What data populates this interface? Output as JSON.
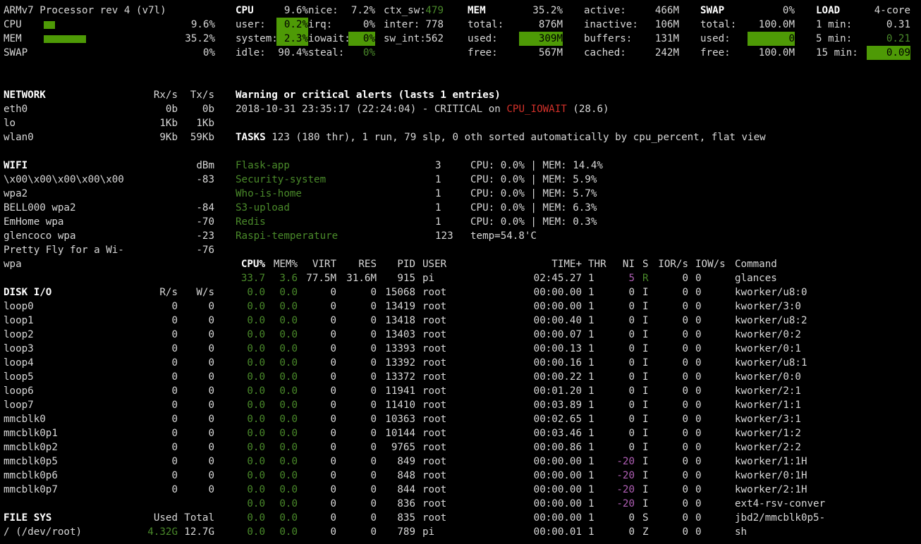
{
  "quicklook": {
    "processor": "ARMv7 Processor rev 4 (v7l)",
    "rows": [
      {
        "label": "CPU",
        "value": "9.6%",
        "fraction": 0.096
      },
      {
        "label": "MEM",
        "value": "35.2%",
        "fraction": 0.352
      },
      {
        "label": "SWAP",
        "value": "0%",
        "fraction": 0
      }
    ]
  },
  "cpu": {
    "title": "CPU",
    "total": "9.6%",
    "rows": [
      {
        "label": "user:",
        "value": "0.2%"
      },
      {
        "label": "system:",
        "value": "2.3%"
      },
      {
        "label": "idle:",
        "value": "90.4%"
      }
    ],
    "rows2": [
      {
        "label": "nice:",
        "value": "7.2%"
      },
      {
        "label": "irq:",
        "value": "0%"
      },
      {
        "label": "iowait:",
        "value": "0%"
      },
      {
        "label": "steal:",
        "value": "0%"
      }
    ],
    "rows3": [
      {
        "label": "ctx_sw:",
        "value": "479"
      },
      {
        "label": "inter:",
        "value": "778"
      },
      {
        "label": "sw_int:",
        "value": "562"
      }
    ]
  },
  "mem": {
    "title": "MEM",
    "percent": "35.2%",
    "rows": [
      {
        "label": "total:",
        "value": "876M"
      },
      {
        "label": "used:",
        "value": "309M"
      },
      {
        "label": "free:",
        "value": "567M"
      }
    ],
    "rows2": [
      {
        "label": "active:",
        "value": "466M"
      },
      {
        "label": "inactive:",
        "value": "106M"
      },
      {
        "label": "buffers:",
        "value": "131M"
      },
      {
        "label": "cached:",
        "value": "242M"
      }
    ]
  },
  "swap": {
    "title": "SWAP",
    "percent": "0%",
    "rows": [
      {
        "label": "total:",
        "value": "100.0M"
      },
      {
        "label": "used:",
        "value": "0"
      },
      {
        "label": "free:",
        "value": "100.0M"
      }
    ]
  },
  "load": {
    "title": "LOAD",
    "cores": "4-core",
    "rows": [
      {
        "label": "1 min:",
        "value": "0.31"
      },
      {
        "label": "5 min:",
        "value": "0.21"
      },
      {
        "label": "15 min:",
        "value": "0.09"
      }
    ]
  },
  "network": {
    "title": "NETWORK",
    "rx": "Rx/s",
    "tx": "Tx/s",
    "rows": [
      {
        "name": "eth0",
        "rx": "0b",
        "tx": "0b"
      },
      {
        "name": "lo",
        "rx": "1Kb",
        "tx": "1Kb"
      },
      {
        "name": "wlan0",
        "rx": "9Kb",
        "tx": "59Kb"
      }
    ]
  },
  "wifi": {
    "title": "WIFI",
    "unit": "dBm",
    "rows": [
      {
        "name": "\\x00\\x00\\x00\\x00\\x00",
        "value": "-83"
      },
      {
        "name": "wpa2",
        "value": ""
      },
      {
        "name": "BELL000 wpa2",
        "value": "-84"
      },
      {
        "name": "EmHome wpa",
        "value": "-70"
      },
      {
        "name": "glencoco wpa",
        "value": "-23"
      },
      {
        "name": "Pretty Fly for a Wi-",
        "value": "-76"
      },
      {
        "name": "wpa",
        "value": ""
      }
    ]
  },
  "disk": {
    "title": "DISK I/O",
    "r": "R/s",
    "w": "W/s",
    "rows": [
      {
        "name": "loop0",
        "r": "0",
        "w": "0"
      },
      {
        "name": "loop1",
        "r": "0",
        "w": "0"
      },
      {
        "name": "loop2",
        "r": "0",
        "w": "0"
      },
      {
        "name": "loop3",
        "r": "0",
        "w": "0"
      },
      {
        "name": "loop4",
        "r": "0",
        "w": "0"
      },
      {
        "name": "loop5",
        "r": "0",
        "w": "0"
      },
      {
        "name": "loop6",
        "r": "0",
        "w": "0"
      },
      {
        "name": "loop7",
        "r": "0",
        "w": "0"
      },
      {
        "name": "mmcblk0",
        "r": "0",
        "w": "0"
      },
      {
        "name": "mmcblk0p1",
        "r": "0",
        "w": "0"
      },
      {
        "name": "mmcblk0p2",
        "r": "0",
        "w": "0"
      },
      {
        "name": "mmcblk0p5",
        "r": "0",
        "w": "0"
      },
      {
        "name": "mmcblk0p6",
        "r": "0",
        "w": "0"
      },
      {
        "name": "mmcblk0p7",
        "r": "0",
        "w": "0"
      }
    ]
  },
  "fs": {
    "title": "FILE SYS",
    "used": "Used",
    "total": "Total",
    "rows": [
      {
        "name": "/ (/dev/root)",
        "used": "4.32G",
        "total": "12.7G"
      }
    ]
  },
  "alerts": {
    "title": "Warning or critical alerts (lasts 1 entries)",
    "entry_prefix": "2018-10-31 23:35:17 (22:24:04) - CRITICAL on ",
    "entry_key": "CPU_IOWAIT",
    "entry_suffix": " (28.6)"
  },
  "tasks": {
    "label": "TASKS",
    "summary": " 123 (180 thr), 1 run, 79 slp, 0 oth sorted automatically by cpu_percent, flat view"
  },
  "amps": [
    {
      "name": "Flask-app",
      "count": "3",
      "info": "CPU: 0.0% | MEM: 14.4%"
    },
    {
      "name": "Security-system",
      "count": "1",
      "info": "CPU: 0.0% | MEM: 5.9%"
    },
    {
      "name": "Who-is-home",
      "count": "1",
      "info": "CPU: 0.0% | MEM: 5.7%"
    },
    {
      "name": "S3-upload",
      "count": "1",
      "info": "CPU: 0.0% | MEM: 6.3%"
    },
    {
      "name": "Redis",
      "count": "1",
      "info": "CPU: 0.0% | MEM: 0.3%"
    },
    {
      "name": "Raspi-temperature",
      "count": "123",
      "info": "temp=54.8'C"
    }
  ],
  "proc_headers": {
    "cpu": "CPU%",
    "mem": "MEM%",
    "virt": "VIRT",
    "res": "RES",
    "pid": "PID",
    "user": "USER",
    "time": "TIME+",
    "thr": "THR",
    "ni": "NI",
    "s": "S",
    "ior": "IOR/s",
    "iow": "IOW/s",
    "cmd": "Command"
  },
  "processes": [
    {
      "cpu": "33.7",
      "mem": "3.6",
      "virt": "77.5M",
      "res": "31.6M",
      "pid": "915",
      "user": "pi",
      "time": "02:45.27",
      "thr": "1",
      "ni": "5",
      "s": "R",
      "ior": "0",
      "iow": "0",
      "cmd": "glances"
    },
    {
      "cpu": "0.0",
      "mem": "0.0",
      "virt": "0",
      "res": "0",
      "pid": "15068",
      "user": "root",
      "time": "00:00.00",
      "thr": "1",
      "ni": "0",
      "s": "I",
      "ior": "0",
      "iow": "0",
      "cmd": "kworker/u8:0"
    },
    {
      "cpu": "0.0",
      "mem": "0.0",
      "virt": "0",
      "res": "0",
      "pid": "13419",
      "user": "root",
      "time": "00:00.00",
      "thr": "1",
      "ni": "0",
      "s": "I",
      "ior": "0",
      "iow": "0",
      "cmd": "kworker/3:0"
    },
    {
      "cpu": "0.0",
      "mem": "0.0",
      "virt": "0",
      "res": "0",
      "pid": "13418",
      "user": "root",
      "time": "00:00.40",
      "thr": "1",
      "ni": "0",
      "s": "I",
      "ior": "0",
      "iow": "0",
      "cmd": "kworker/u8:2"
    },
    {
      "cpu": "0.0",
      "mem": "0.0",
      "virt": "0",
      "res": "0",
      "pid": "13403",
      "user": "root",
      "time": "00:00.07",
      "thr": "1",
      "ni": "0",
      "s": "I",
      "ior": "0",
      "iow": "0",
      "cmd": "kworker/0:2"
    },
    {
      "cpu": "0.0",
      "mem": "0.0",
      "virt": "0",
      "res": "0",
      "pid": "13393",
      "user": "root",
      "time": "00:00.13",
      "thr": "1",
      "ni": "0",
      "s": "I",
      "ior": "0",
      "iow": "0",
      "cmd": "kworker/0:1"
    },
    {
      "cpu": "0.0",
      "mem": "0.0",
      "virt": "0",
      "res": "0",
      "pid": "13392",
      "user": "root",
      "time": "00:00.16",
      "thr": "1",
      "ni": "0",
      "s": "I",
      "ior": "0",
      "iow": "0",
      "cmd": "kworker/u8:1"
    },
    {
      "cpu": "0.0",
      "mem": "0.0",
      "virt": "0",
      "res": "0",
      "pid": "13372",
      "user": "root",
      "time": "00:00.22",
      "thr": "1",
      "ni": "0",
      "s": "I",
      "ior": "0",
      "iow": "0",
      "cmd": "kworker/0:0"
    },
    {
      "cpu": "0.0",
      "mem": "0.0",
      "virt": "0",
      "res": "0",
      "pid": "11941",
      "user": "root",
      "time": "00:01.20",
      "thr": "1",
      "ni": "0",
      "s": "I",
      "ior": "0",
      "iow": "0",
      "cmd": "kworker/2:1"
    },
    {
      "cpu": "0.0",
      "mem": "0.0",
      "virt": "0",
      "res": "0",
      "pid": "11410",
      "user": "root",
      "time": "00:03.89",
      "thr": "1",
      "ni": "0",
      "s": "I",
      "ior": "0",
      "iow": "0",
      "cmd": "kworker/1:1"
    },
    {
      "cpu": "0.0",
      "mem": "0.0",
      "virt": "0",
      "res": "0",
      "pid": "10363",
      "user": "root",
      "time": "00:02.65",
      "thr": "1",
      "ni": "0",
      "s": "I",
      "ior": "0",
      "iow": "0",
      "cmd": "kworker/3:1"
    },
    {
      "cpu": "0.0",
      "mem": "0.0",
      "virt": "0",
      "res": "0",
      "pid": "10144",
      "user": "root",
      "time": "00:03.46",
      "thr": "1",
      "ni": "0",
      "s": "I",
      "ior": "0",
      "iow": "0",
      "cmd": "kworker/1:2"
    },
    {
      "cpu": "0.0",
      "mem": "0.0",
      "virt": "0",
      "res": "0",
      "pid": "9765",
      "user": "root",
      "time": "00:00.86",
      "thr": "1",
      "ni": "0",
      "s": "I",
      "ior": "0",
      "iow": "0",
      "cmd": "kworker/2:2"
    },
    {
      "cpu": "0.0",
      "mem": "0.0",
      "virt": "0",
      "res": "0",
      "pid": "849",
      "user": "root",
      "time": "00:00.00",
      "thr": "1",
      "ni": "-20",
      "s": "I",
      "ior": "0",
      "iow": "0",
      "cmd": "kworker/1:1H"
    },
    {
      "cpu": "0.0",
      "mem": "0.0",
      "virt": "0",
      "res": "0",
      "pid": "848",
      "user": "root",
      "time": "00:00.00",
      "thr": "1",
      "ni": "-20",
      "s": "I",
      "ior": "0",
      "iow": "0",
      "cmd": "kworker/0:1H"
    },
    {
      "cpu": "0.0",
      "mem": "0.0",
      "virt": "0",
      "res": "0",
      "pid": "844",
      "user": "root",
      "time": "00:00.00",
      "thr": "1",
      "ni": "-20",
      "s": "I",
      "ior": "0",
      "iow": "0",
      "cmd": "kworker/2:1H"
    },
    {
      "cpu": "0.0",
      "mem": "0.0",
      "virt": "0",
      "res": "0",
      "pid": "836",
      "user": "root",
      "time": "00:00.00",
      "thr": "1",
      "ni": "-20",
      "s": "I",
      "ior": "0",
      "iow": "0",
      "cmd": "ext4-rsv-conver"
    },
    {
      "cpu": "0.0",
      "mem": "0.0",
      "virt": "0",
      "res": "0",
      "pid": "835",
      "user": "root",
      "time": "00:00.00",
      "thr": "1",
      "ni": "0",
      "s": "S",
      "ior": "0",
      "iow": "0",
      "cmd": "jbd2/mmcblk0p5-"
    },
    {
      "cpu": "0.0",
      "mem": "0.0",
      "virt": "0",
      "res": "0",
      "pid": "789",
      "user": "pi",
      "time": "00:00.01",
      "thr": "1",
      "ni": "0",
      "s": "Z",
      "ior": "0",
      "iow": "0",
      "cmd": "sh"
    }
  ],
  "colors": {
    "accent": "#4e9a06",
    "critical": "#d4312a",
    "nice_neg": "#b05fb5"
  }
}
